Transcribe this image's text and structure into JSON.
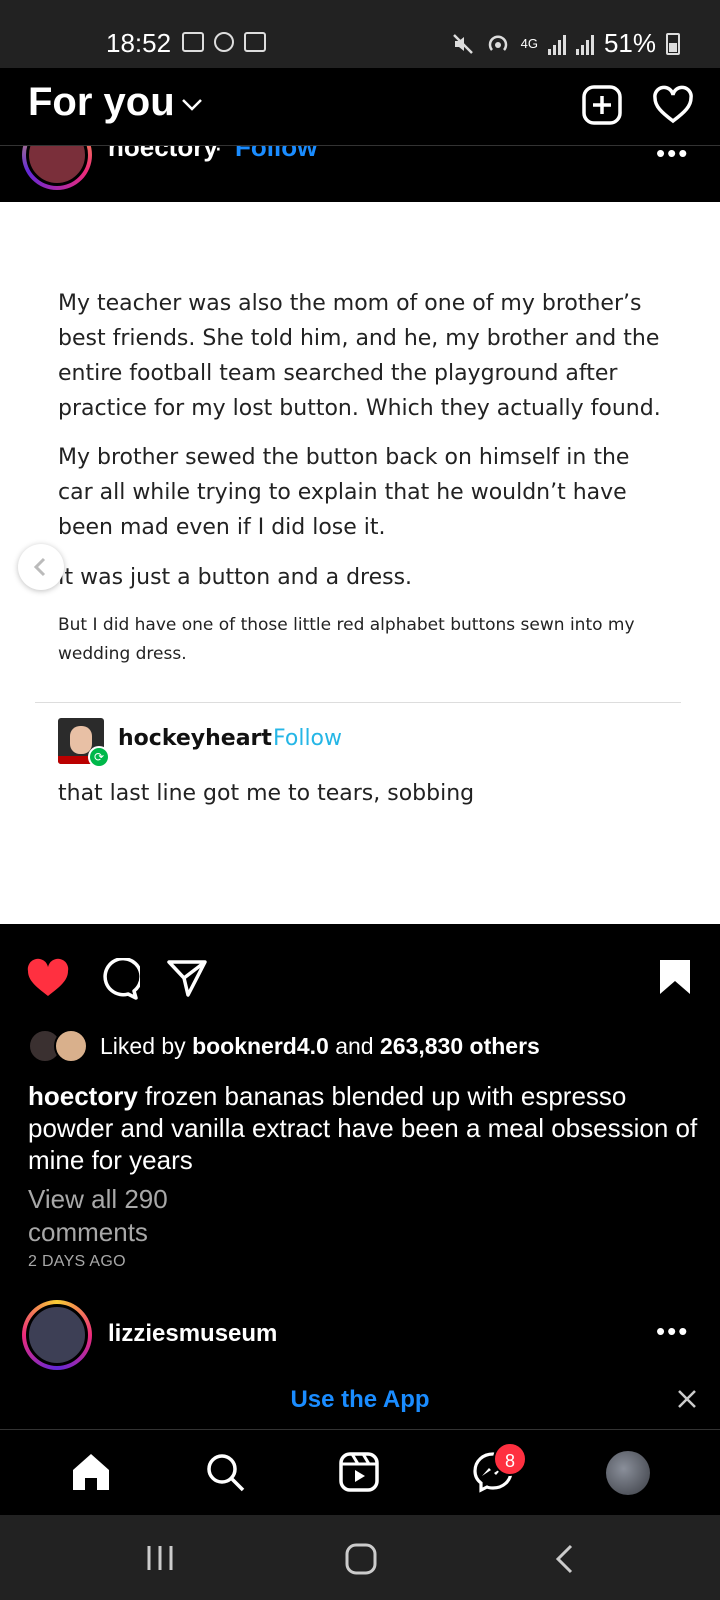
{
  "status_bar": {
    "time": "18:52",
    "network": "4G",
    "battery": "51%"
  },
  "header": {
    "feed_title": "For you"
  },
  "post": {
    "username": "hoectory",
    "separator": "·",
    "follow_label": "Follow",
    "image_text": {
      "paragraphs": [
        "My teacher was also the mom of one of my brother’s best friends. She told him, and he, my brother and the entire football team searched the playground after practice for my lost button. Which they actually found.",
        "My brother sewed the button back on himself in the car all while trying to explain that he wouldn’t have been mad even if I did lose it.",
        "It was just a button and a dress."
      ],
      "small_paragraph": "But I did have one of those little red alphabet buttons sewn into my wedding dress.",
      "reblogger_name": "hockeyheart",
      "reblogger_follow": "Follow",
      "reblog_comment": "that last line got me to tears, sobbing"
    },
    "likes": {
      "prefix": "Liked by",
      "liker": "booknerd4.0",
      "conjunction": "and",
      "others": "263,830 others"
    },
    "caption": {
      "username": "hoectory",
      "text": "frozen bananas blended up with espresso powder and vanilla extract have been a meal obsession of mine for years"
    },
    "view_comments": "View all 290 comments",
    "date": "2 DAYS AGO"
  },
  "next_post": {
    "username": "lizziesmuseum"
  },
  "app_banner": {
    "label": "Use the App"
  },
  "bottom_nav": {
    "items": [
      "home-icon",
      "search-icon",
      "reels-icon",
      "messenger-icon",
      "profile-avatar"
    ],
    "messages_badge": "8"
  },
  "colors": {
    "link_blue": "#1a8cff",
    "tumblr_follow": "#25b6e6",
    "like_red": "#ff3040",
    "background": "#000000"
  }
}
